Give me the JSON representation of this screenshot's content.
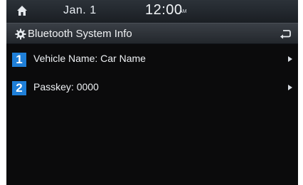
{
  "status_bar": {
    "date": "Jan.  1",
    "time": "12:00",
    "ampm": "AM"
  },
  "header": {
    "title": "Bluetooth System Info",
    "icons": {
      "settings": "gear-icon",
      "back": "back-icon",
      "home": "home-icon"
    }
  },
  "items": [
    {
      "number": "1",
      "label": "Vehicle Name: Car Name"
    },
    {
      "number": "2",
      "label": "Passkey: 0000"
    }
  ],
  "colors": {
    "accent": "#1f7fd8",
    "background": "#0b0b0c"
  }
}
